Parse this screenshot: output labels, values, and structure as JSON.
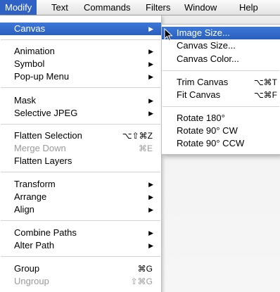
{
  "menubar": {
    "items": [
      "Modify",
      "Text",
      "Commands",
      "Filters",
      "Window",
      "Help"
    ]
  },
  "modify_menu": {
    "items": [
      {
        "label": "Canvas",
        "submenu": true
      },
      {
        "label": "Animation",
        "submenu": true
      },
      {
        "label": "Symbol",
        "submenu": true
      },
      {
        "label": "Pop-up Menu",
        "submenu": true
      },
      {
        "label": "Mask",
        "submenu": true
      },
      {
        "label": "Selective JPEG",
        "submenu": true
      },
      {
        "label": "Flatten Selection",
        "shortcut": "⌥⇧⌘Z"
      },
      {
        "label": "Merge Down",
        "shortcut": "⌘E",
        "disabled": true
      },
      {
        "label": "Flatten Layers"
      },
      {
        "label": "Transform",
        "submenu": true
      },
      {
        "label": "Arrange",
        "submenu": true
      },
      {
        "label": "Align",
        "submenu": true
      },
      {
        "label": "Combine Paths",
        "submenu": true
      },
      {
        "label": "Alter Path",
        "submenu": true
      },
      {
        "label": "Group",
        "shortcut": "⌘G"
      },
      {
        "label": "Ungroup",
        "shortcut": "⇧⌘G",
        "disabled": true
      }
    ],
    "submenu_arrow": "▶"
  },
  "canvas_submenu": {
    "items": [
      {
        "label": "Image Size..."
      },
      {
        "label": "Canvas Size..."
      },
      {
        "label": "Canvas Color..."
      },
      {
        "label": "Trim Canvas",
        "shortcut": "⌥⌘T"
      },
      {
        "label": "Fit Canvas",
        "shortcut": "⌥⌘F"
      },
      {
        "label": "Rotate 180°"
      },
      {
        "label": "Rotate 90° CW"
      },
      {
        "label": "Rotate 90° CCW"
      }
    ]
  },
  "colors": {
    "highlight": "#2f62c4",
    "disabled_text": "#9a9a9a"
  },
  "icons": {
    "pointer": "mouse-pointer-icon",
    "submenu": "submenu-arrow-icon"
  }
}
